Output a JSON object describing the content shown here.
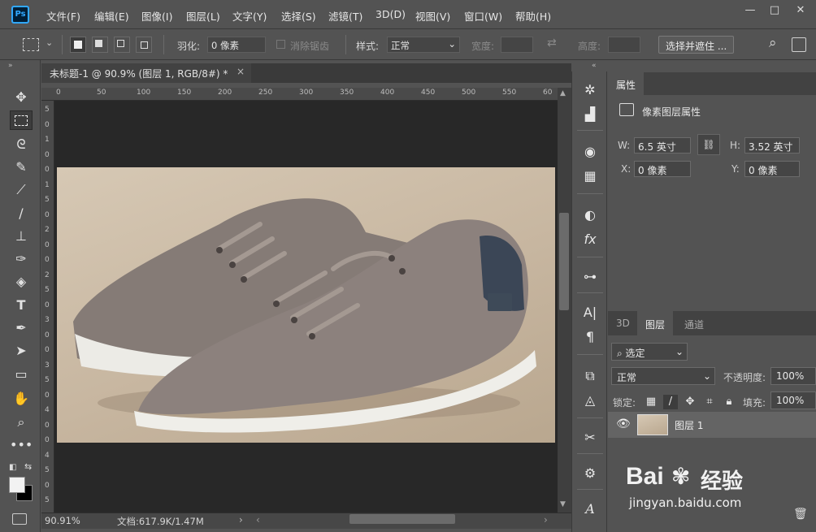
{
  "app": {
    "logo": "Ps",
    "window_controls": [
      "—",
      "□",
      "✕"
    ]
  },
  "menu": [
    "文件(F)",
    "编辑(E)",
    "图像(I)",
    "图层(L)",
    "文字(Y)",
    "选择(S)",
    "滤镜(T)",
    "3D(D)",
    "视图(V)",
    "窗口(W)",
    "帮助(H)"
  ],
  "options": {
    "feather_label": "羽化:",
    "feather_value": "0 像素",
    "antialias_label": "消除锯齿",
    "style_label": "样式:",
    "style_value": "正常",
    "width_label": "宽度:",
    "height_label": "高度:",
    "select_mask_button": "选择并遮住 ..."
  },
  "document": {
    "tab_title": "未标题-1 @ 90.9% (图层 1, RGB/8#) *",
    "tab_close": "×",
    "ruler_h": [
      "0",
      "50",
      "100",
      "150",
      "200",
      "250",
      "300",
      "350",
      "400",
      "450",
      "500",
      "550",
      "60"
    ],
    "ruler_v": [
      "5",
      "0",
      "1",
      "0",
      "0",
      "1",
      "5",
      "0",
      "2",
      "0",
      "0",
      "2",
      "5",
      "0",
      "3",
      "0",
      "0",
      "3",
      "5",
      "0",
      "4",
      "0",
      "0",
      "4",
      "5",
      "0",
      "5"
    ],
    "zoom": "90.91%",
    "doc_info": "文档:617.9K/1.47M",
    "status_arrow": "›"
  },
  "properties": {
    "tab": "属性",
    "type_label": "像素图层属性",
    "w_label": "W:",
    "w_value": "6.5 英寸",
    "h_label": "H:",
    "h_value": "3.52 英寸",
    "x_label": "X:",
    "x_value": "0 像素",
    "y_label": "Y:",
    "y_value": "0 像素"
  },
  "layers": {
    "tabs": [
      "3D",
      "图层",
      "通道"
    ],
    "filter_label": "选定",
    "blend_mode": "正常",
    "opacity_label": "不透明度:",
    "opacity_value": "100%",
    "lock_label": "锁定:",
    "fill_label": "填充:",
    "fill_value": "100%",
    "layer_name": "图层 1"
  },
  "watermark": {
    "brand": "Bai",
    "brand_suffix": "经验",
    "url": "jingyan.baidu.com"
  },
  "colors": {
    "accent": "#31a8ff",
    "panel": "#535353",
    "canvas": "#282828"
  }
}
